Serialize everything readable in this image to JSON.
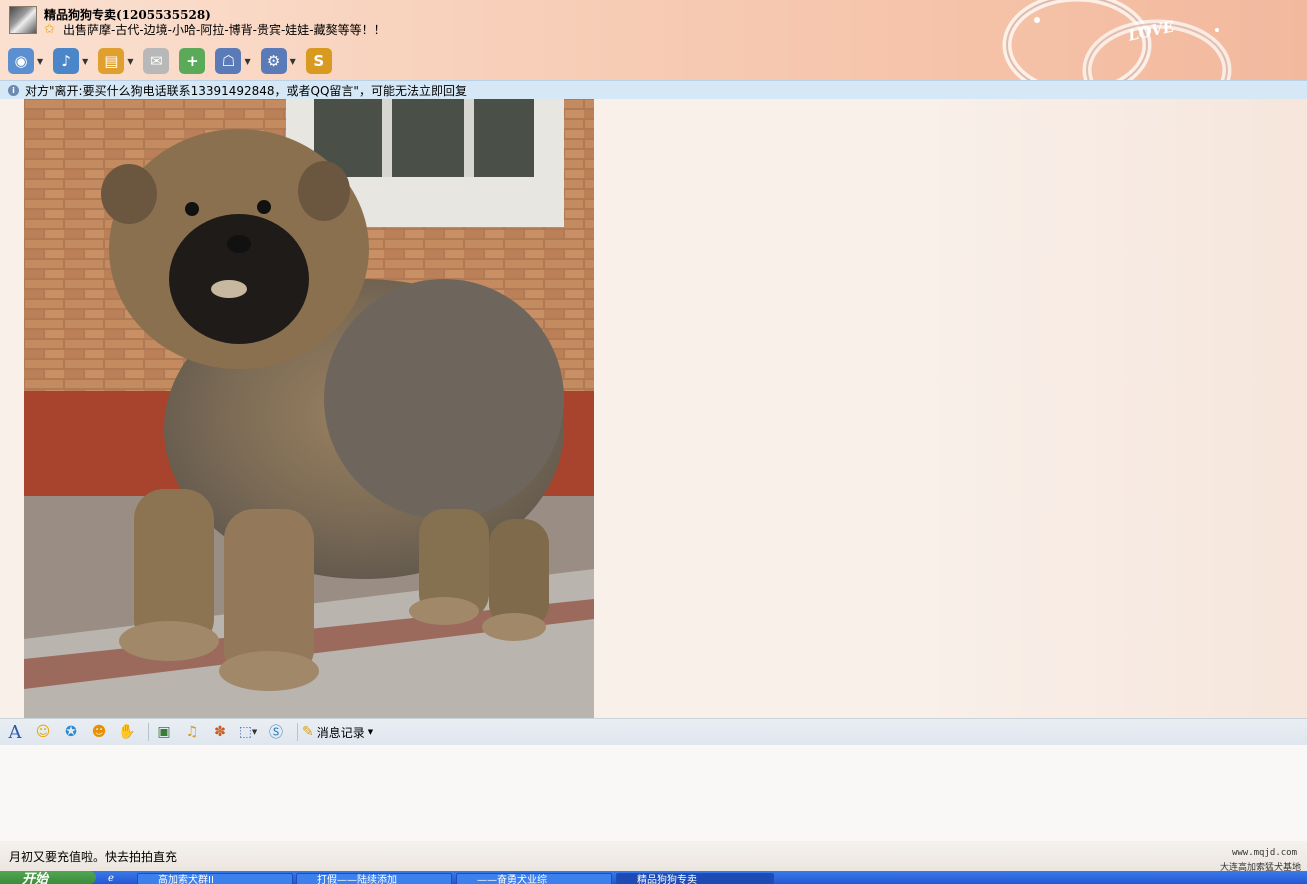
{
  "window": {
    "title": "精品狗狗专卖(1205535528)",
    "signature": "出售萨摩-古代-边境-小哈-阿拉-博背-贵宾-娃娃-藏獒等等！！",
    "deco_text": "LOVE"
  },
  "toolbar": {
    "buttons": [
      {
        "name": "video-call",
        "icon": "◉",
        "color": "#5b8fd0",
        "caret": "▼"
      },
      {
        "name": "voice-call",
        "icon": "♪",
        "color": "#4a86c8",
        "caret": "▼"
      },
      {
        "name": "send-file",
        "icon": "▤",
        "color": "#e0a030",
        "caret": "▼"
      },
      {
        "name": "send-mail",
        "icon": "✉",
        "color": "#b8b8b8",
        "caret": ""
      },
      {
        "name": "create-group",
        "icon": "+",
        "color": "#5aaa5a",
        "caret": ""
      },
      {
        "name": "remote-assist",
        "icon": "☖",
        "color": "#5a7ab8",
        "caret": "▼"
      },
      {
        "name": "app-settings",
        "icon": "⚙",
        "color": "#5a7ab8",
        "caret": "▼"
      },
      {
        "name": "soso",
        "icon": "S",
        "color": "#d89a20",
        "caret": ""
      }
    ]
  },
  "notice": {
    "text": "对方\"离开:要买什么狗电话联系13391492848，或者QQ留言\"，可能无法立即回复"
  },
  "input_toolbar": {
    "font_icon": "A",
    "history_label": "消息记录",
    "history_caret": "▼"
  },
  "status_line": {
    "text": "月初又要充值啦。快去拍拍直充",
    "site": "www.mqjd.com",
    "site_sub": "大连高加索猛犬基地"
  },
  "taskbar": {
    "start": "开始",
    "items": [
      {
        "label": "高加索犬群II",
        "active": false
      },
      {
        "label": "打假——陆续添加",
        "active": false
      },
      {
        "label": "——奋勇犬业综",
        "active": false
      },
      {
        "label": "精品狗狗专卖",
        "active": true
      }
    ]
  }
}
